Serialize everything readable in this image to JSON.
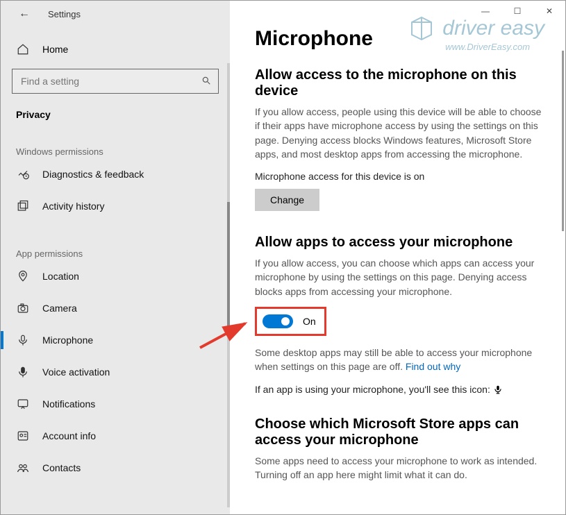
{
  "window": {
    "title": "Settings",
    "controls": {
      "min": "—",
      "max": "☐",
      "close": "✕"
    }
  },
  "sidebar": {
    "home": "Home",
    "search_placeholder": "Find a setting",
    "current": "Privacy",
    "group1_label": "Windows permissions",
    "group2_label": "App permissions",
    "items_win": [
      {
        "icon": "diagnostics",
        "label": "Diagnostics & feedback"
      },
      {
        "icon": "history",
        "label": "Activity history"
      }
    ],
    "items_app": [
      {
        "icon": "location",
        "label": "Location"
      },
      {
        "icon": "camera",
        "label": "Camera"
      },
      {
        "icon": "mic",
        "label": "Microphone",
        "active": true
      },
      {
        "icon": "voice",
        "label": "Voice activation"
      },
      {
        "icon": "notif",
        "label": "Notifications"
      },
      {
        "icon": "account",
        "label": "Account info"
      },
      {
        "icon": "contacts",
        "label": "Contacts"
      }
    ]
  },
  "page": {
    "title": "Microphone",
    "sec1": {
      "heading": "Allow access to the microphone on this device",
      "body": "If you allow access, people using this device will be able to choose if their apps have microphone access by using the settings on this page. Denying access blocks Windows features, Microsoft Store apps, and most desktop apps from accessing the microphone.",
      "status": "Microphone access for this device is on",
      "change_btn": "Change"
    },
    "sec2": {
      "heading": "Allow apps to access your microphone",
      "body": "If you allow access, you can choose which apps can access your microphone by using the settings on this page. Denying access blocks apps from accessing your microphone.",
      "toggle_state": "On",
      "note_pre": "Some desktop apps may still be able to access your microphone when settings on this page are off. ",
      "note_link": "Find out why",
      "inuse": "If an app is using your microphone, you'll see this icon:"
    },
    "sec3": {
      "heading": "Choose which Microsoft Store apps can access your microphone",
      "body": "Some apps need to access your microphone to work as intended. Turning off an app here might limit what it can do."
    }
  },
  "watermark": {
    "main": "driver easy",
    "sub": "www.DriverEasy.com"
  }
}
